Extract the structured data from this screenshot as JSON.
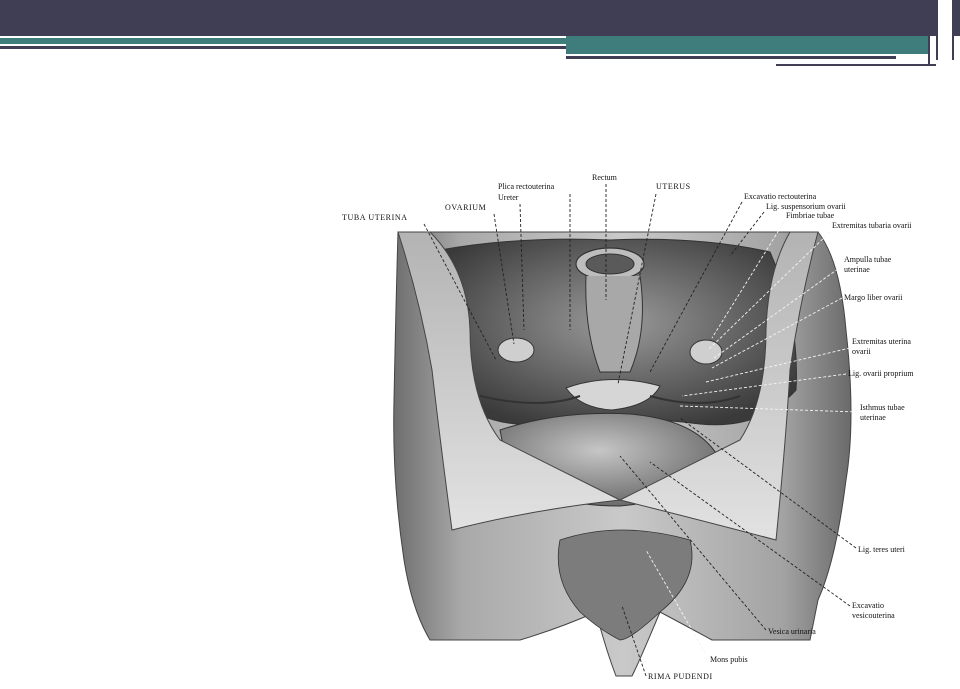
{
  "labels": {
    "rectum": "Rectum",
    "plica_rectouterina": "Plica rectouterina",
    "ureter": "Ureter",
    "uterus": "UTERUS",
    "ovarium": "OVARIUM",
    "tuba_uterina": "TUBA UTERINA",
    "excavatio_rectouterina": "Excavatio rectouterina",
    "lig_suspensorium_ovarii": "Lig. suspensorium ovarii",
    "fimbriae_tubae": "Fimbriae tubae",
    "extremitas_tubaria_ovarii": "Extremitas tubaria ovarii",
    "ampulla_tubae_1": "Ampulla tubae",
    "ampulla_tubae_2": "uterinae",
    "margo_liber_ovarii": "Margo liber ovarii",
    "extremitas_uterina_1": "Extremitas uterina",
    "extremitas_uterina_2": "ovarii",
    "lig_ovarii_proprium": "Lig. ovarii proprium",
    "isthmus_tubae_1": "Isthmus tubae",
    "isthmus_tubae_2": "uterinae",
    "lig_teres_uteri": "Lig. teres uteri",
    "excavatio_vesico_1": "Excavatio",
    "excavatio_vesico_2": "vesicouterina",
    "vesica_urinaria": "Vesica urinaria",
    "mons_pubis": "Mons pubis",
    "rima_pudendi": "RIMA PUDENDI"
  }
}
